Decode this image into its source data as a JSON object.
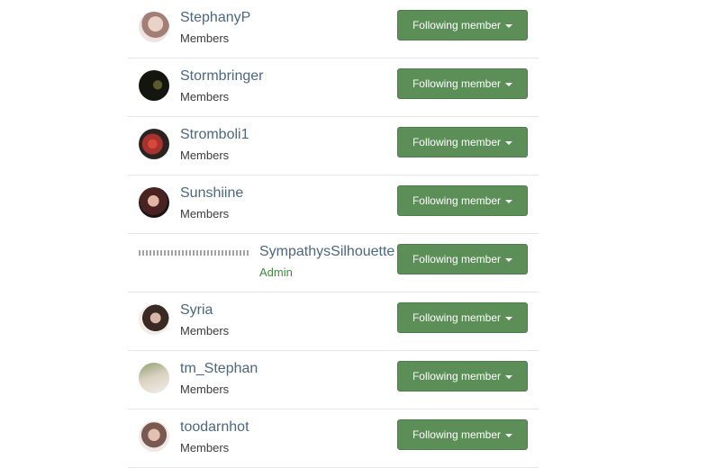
{
  "members": [
    {
      "name": "StephanyP",
      "role": "Members",
      "button": "Following member"
    },
    {
      "name": "Stormbringer",
      "role": "Members",
      "button": "Following member"
    },
    {
      "name": "Stromboli1",
      "role": "Members",
      "button": "Following member"
    },
    {
      "name": "Sunshiine",
      "role": "Members",
      "button": "Following member"
    },
    {
      "name": "SympathysSilhouette",
      "role": "Admin",
      "button": "Following member"
    },
    {
      "name": "Syria",
      "role": "Members",
      "button": "Following member"
    },
    {
      "name": "tm_Stephan",
      "role": "Members",
      "button": "Following member"
    },
    {
      "name": "toodarnhot",
      "role": "Members",
      "button": "Following member"
    }
  ],
  "colors": {
    "button_bg": "#5b8f57",
    "name_text": "#4b6782",
    "admin_role": "#3a8f3a"
  },
  "icons": {
    "dropdown": "caret-down-icon"
  }
}
